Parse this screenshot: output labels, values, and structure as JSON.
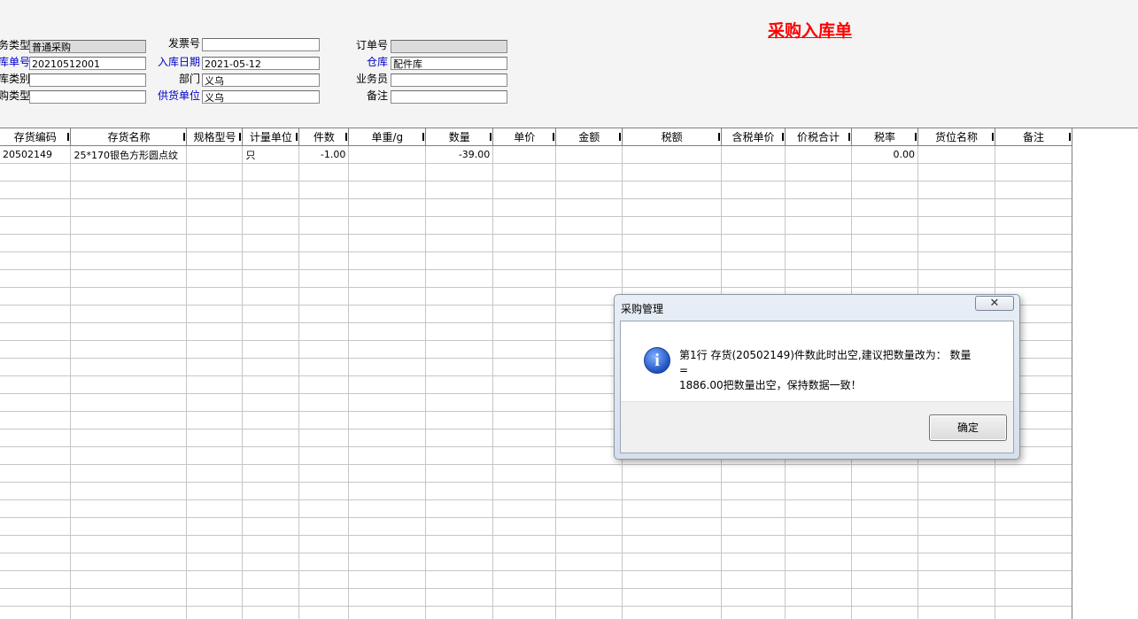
{
  "header": {
    "title": "采购入库单",
    "fields": {
      "business_type": {
        "label": "务类型",
        "value": "普通采购"
      },
      "receipt_no": {
        "label": "库单号",
        "value": "20210512001"
      },
      "receipt_category": {
        "label": "库类别",
        "value": ""
      },
      "purchase_type": {
        "label": "购类型",
        "value": ""
      },
      "invoice_no": {
        "label": "发票号",
        "value": ""
      },
      "receipt_date": {
        "label": "入库日期",
        "value": "2021-05-12"
      },
      "department": {
        "label": "部门",
        "value": "义乌"
      },
      "supplier": {
        "label": "供货单位",
        "value": "义乌"
      },
      "order_no": {
        "label": "订单号",
        "value": ""
      },
      "warehouse": {
        "label": "仓库",
        "value": "配件库"
      },
      "salesperson": {
        "label": "业务员",
        "value": ""
      },
      "remark": {
        "label": "备注",
        "value": ""
      }
    }
  },
  "grid": {
    "columns": [
      "存货编码",
      "存货名称",
      "规格型号",
      "计量单位",
      "件数",
      "单重/g",
      "数量",
      "单价",
      "金额",
      "税额",
      "含税单价",
      "价税合计",
      "税率",
      "货位名称",
      "备注"
    ],
    "rows": [
      [
        "20502149",
        "25*170银色方形圆点纹",
        "",
        "只",
        "-1.00",
        "",
        "-39.00",
        "",
        "",
        "",
        "",
        "",
        "0.00",
        "",
        ""
      ]
    ]
  },
  "dialog": {
    "title": "采购管理",
    "close_glyph": "✕",
    "icon": "info-icon",
    "message_line1": "第1行 存货(20502149)件数此时出空,建议把数量改为： 数量 =",
    "message_line2": "1886.00把数量出空，保持数据一致！",
    "ok_label": "确定"
  }
}
